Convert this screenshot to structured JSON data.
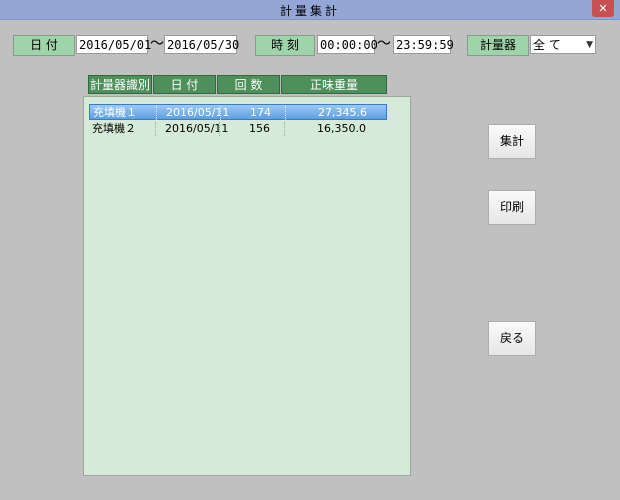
{
  "window": {
    "title": "計量集計",
    "close_glyph": "✕"
  },
  "filters": {
    "date_label": "日 付",
    "date_from": "2016/05/01",
    "date_to": "2016/05/30",
    "separator": "～",
    "time_label": "時 刻",
    "time_from": "00:00:00",
    "time_to": "23:59:59",
    "scale_label": "計量器",
    "scale_value": "全 て",
    "dropdown_icon": "chevron-down-icon"
  },
  "table": {
    "columns": [
      "計量器識別",
      "日 付",
      "回 数",
      "正味重量"
    ],
    "rows": [
      {
        "scale": "充填機１",
        "date": "2016/05/11",
        "count": "174",
        "net_weight": "27,345.6",
        "selected": true
      },
      {
        "scale": "充填機２",
        "date": "2016/05/11",
        "count": "156",
        "net_weight": "16,350.0",
        "selected": false
      }
    ]
  },
  "buttons": {
    "aggregate": "集計",
    "print": "印刷",
    "back": "戻る"
  },
  "colors": {
    "title_bar": "#93a6d6",
    "label_green": "#9fd3a9",
    "header_green": "#4e8f5c",
    "list_background": "#d6ead8",
    "selection_blue": "#5d9ee3",
    "close_red": "#c75050"
  }
}
